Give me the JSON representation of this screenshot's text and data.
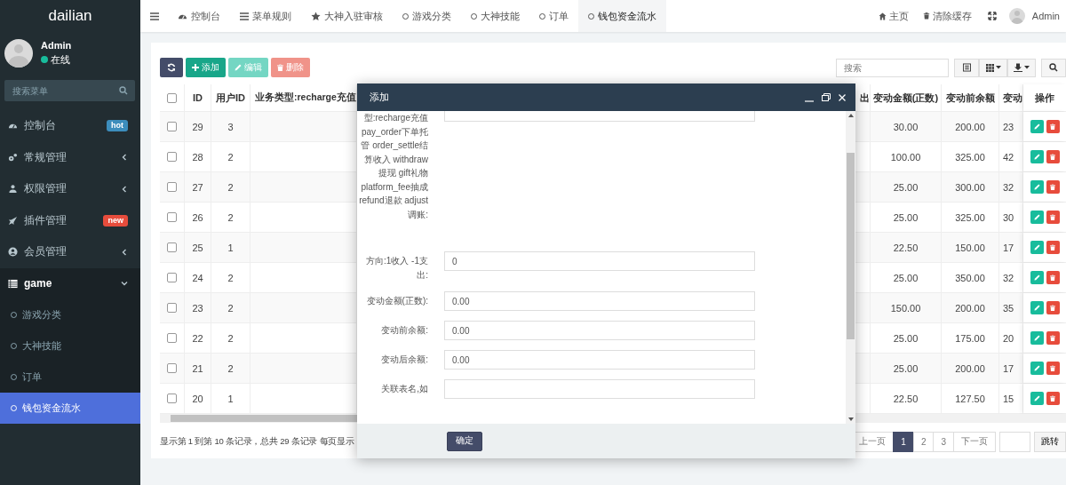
{
  "sidebar": {
    "logo": "dailian",
    "user": {
      "name": "Admin",
      "status": "在线",
      "online": true
    },
    "search": {
      "placeholder": "搜索菜单"
    },
    "items": [
      {
        "label": "控制台",
        "selected": false,
        "expanded": false,
        "badge": {
          "text": "hot",
          "color": "#3c8dbc"
        }
      },
      {
        "label": "常规管理",
        "selected": false,
        "expanded": false
      },
      {
        "label": "权限管理",
        "selected": false,
        "expanded": false
      },
      {
        "label": "插件管理",
        "selected": false,
        "expanded": false,
        "badge": {
          "text": "new",
          "color": "#e74c3c"
        }
      },
      {
        "label": "会员管理",
        "selected": false,
        "expanded": false
      },
      {
        "label": "game",
        "selected": false,
        "expanded": true,
        "children": [
          {
            "label": "游戏分类",
            "selected": false
          },
          {
            "label": "大神技能",
            "selected": false
          },
          {
            "label": "订单",
            "selected": false
          },
          {
            "label": "钱包资金流水",
            "selected": true
          }
        ]
      }
    ]
  },
  "top_nav": {
    "tabs": [
      {
        "label": "控制台",
        "selected": false
      },
      {
        "label": "菜单规则",
        "selected": false
      },
      {
        "label": "大神入驻审核",
        "selected": false
      },
      {
        "label": "游戏分类",
        "selected": false
      },
      {
        "label": "大神技能",
        "selected": false
      },
      {
        "label": "订单",
        "selected": false
      },
      {
        "label": "钱包资金流水",
        "selected": true
      }
    ],
    "links": [
      "主页",
      "清除缓存"
    ],
    "user": "Admin"
  },
  "toolbar": {
    "buttons": [
      {
        "kind": "refresh",
        "disabled": false
      },
      {
        "kind": "add",
        "label": "添加",
        "disabled": false
      },
      {
        "kind": "edit",
        "label": "编辑",
        "disabled": true
      },
      {
        "kind": "delete",
        "label": "删除",
        "disabled": true
      }
    ],
    "search": {
      "placeholder": "搜索"
    }
  },
  "table": {
    "all_checked": false,
    "columns": {
      "id": "ID",
      "user_id": "用户ID",
      "type": "业务类型:recharge充值",
      "column_5": "出",
      "amount": "变动金额(正数)",
      "before": "变动前余额",
      "column_8": "变动",
      "actions": "操作"
    },
    "rows": [
      {
        "checked": false,
        "id": "29",
        "user_id": "3",
        "amount": "30.00",
        "before": "200.00",
        "column_8": "23"
      },
      {
        "checked": false,
        "id": "28",
        "user_id": "2",
        "amount": "100.00",
        "before": "325.00",
        "column_8": "42"
      },
      {
        "checked": false,
        "id": "27",
        "user_id": "2",
        "amount": "25.00",
        "before": "300.00",
        "column_8": "32"
      },
      {
        "checked": false,
        "id": "26",
        "user_id": "2",
        "amount": "25.00",
        "before": "325.00",
        "column_8": "30"
      },
      {
        "checked": false,
        "id": "25",
        "user_id": "1",
        "amount": "22.50",
        "before": "150.00",
        "column_8": "17"
      },
      {
        "checked": false,
        "id": "24",
        "user_id": "2",
        "amount": "25.00",
        "before": "350.00",
        "column_8": "32"
      },
      {
        "checked": false,
        "id": "23",
        "user_id": "2",
        "amount": "150.00",
        "before": "200.00",
        "column_8": "35"
      },
      {
        "checked": false,
        "id": "22",
        "user_id": "2",
        "amount": "25.00",
        "before": "175.00",
        "column_8": "20"
      },
      {
        "checked": false,
        "id": "21",
        "user_id": "2",
        "amount": "25.00",
        "before": "200.00",
        "column_8": "17"
      },
      {
        "checked": false,
        "id": "20",
        "user_id": "1",
        "amount": "22.50",
        "before": "127.50",
        "column_8": "15"
      }
    ]
  },
  "pagination": {
    "summary": "显示第 1 到第 10 条记录，总共 29 条记录 每页显示",
    "pages": [
      {
        "label": "上一页",
        "selected": false
      },
      {
        "label": "1",
        "selected": true
      },
      {
        "label": "2",
        "selected": false
      },
      {
        "label": "3",
        "selected": false
      },
      {
        "label": "下一页",
        "selected": false
      }
    ],
    "jump": "跳转"
  },
  "modal": {
    "title": "添加",
    "fields": [
      {
        "kind": "partial",
        "label": "型:recharge充值 pay_order下单托管 order_settle结算收入 withdraw提现 gift礼物 platform_fee抽成 refund退款 adjust调账:"
      },
      {
        "kind": "text",
        "label": "方向:1收入 -1支出:",
        "value": "0"
      },
      {
        "kind": "text",
        "label": "变动金额(正数):",
        "value": "0.00"
      },
      {
        "kind": "text",
        "label": "变动前余额:",
        "value": "0.00"
      },
      {
        "kind": "text",
        "label": "变动后余额:",
        "value": "0.00"
      },
      {
        "kind": "text",
        "label": "关联表名,如"
      }
    ],
    "submit": "确定"
  }
}
